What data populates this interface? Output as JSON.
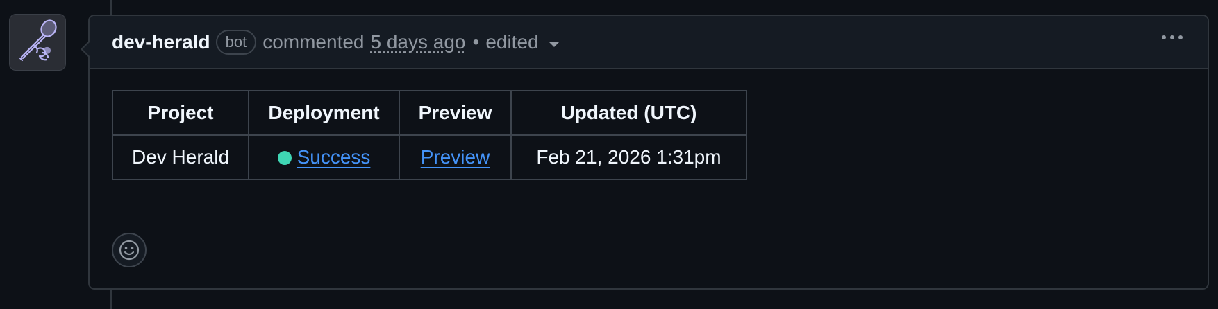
{
  "comment": {
    "author": "dev-herald",
    "badge": "bot",
    "action": "commented",
    "time": "5 days ago",
    "separator": "•",
    "edited": "edited"
  },
  "table": {
    "headers": [
      "Project",
      "Deployment",
      "Preview",
      "Updated (UTC)"
    ],
    "row": {
      "project": "Dev Herald",
      "deployment_status": "Success",
      "preview": "Preview",
      "updated": "Feb 21, 2026 1:31pm"
    }
  },
  "colors": {
    "background": "#0d1117",
    "header_bg": "#151b23",
    "border": "#30363d",
    "link": "#4493f8",
    "status_success": "#3fd6b4",
    "avatar_accent": "#b9b4f5"
  },
  "icons": {
    "avatar": "trumpet-herald-icon",
    "menu": "kebab-horizontal-icon",
    "edit_history": "caret-down-icon",
    "reaction": "smiley-icon"
  }
}
